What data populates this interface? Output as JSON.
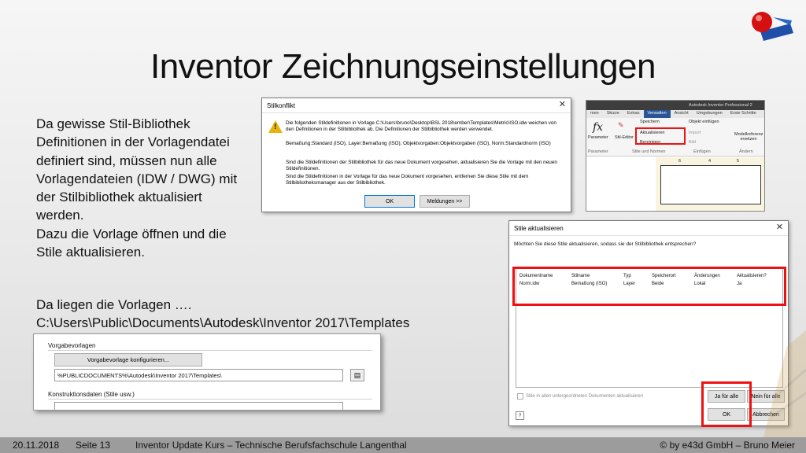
{
  "slide": {
    "title": "Inventor Zeichnungseinstellungen",
    "body_text": "Da gewisse Stil-Bibliothek Definitionen in der Vorlagendatei definiert sind, müssen nun alle Vorlagendateien (IDW / DWG) mit der Stilbibliothek aktualisiert werden.\nDazu die Vorlage öffnen und die Stile aktualisieren.",
    "path_intro": "Da liegen die Vorlagen ….",
    "path": "C:\\Users\\Public\\Documents\\Autodesk\\Inventor 2017\\Templates"
  },
  "stilkonflikt_dialog": {
    "title": "Stilkonflikt",
    "message_1": "Die folgenden Stildefinitionen in Vorlage C:\\Users\\bruno\\Desktop\\BSL 2018\\ember\\Templates\\Metric\\ISO.idw weichen von den Definitionen in der Stilbibliothek ab. Die Definitionen der Stilbibliothek werden verwendet.",
    "message_2": "Bemaßung:Standard (ISO), Layer:Bemaßung (ISO), Objektvorgaben:Objektvorgaben (ISO), Norm:Standardnorm (ISO)",
    "message_3": "Sind die Stildefinitionen der Stilbibliothek für das neue Dokument vorgesehen, aktualisieren Sie die Vorlage mit den neuen Stildefinitionen.",
    "message_4": "Sind die Stildefinitionen in der Vorlage für das neue Dokument vorgesehen, entfernen Sie diese Stile mit dem Stilbibliotheksmanager aus der Stilbibliothek.",
    "ok_label": "OK",
    "details_label": "Meldungen >>"
  },
  "ribbon": {
    "app_title": "Autodesk Inventor Professional 2",
    "tabs": [
      "men",
      "Skizze",
      "Extras",
      "Verwalten",
      "Ansicht",
      "Umgebungen",
      "Erste Schritte"
    ],
    "active_tab": "Verwalten",
    "parameter_label": "Parameter",
    "stil_editor_label": "Stil-Editor",
    "speichern": "Speichern",
    "aktualisieren": "Aktualisieren",
    "bereinigen": "Bereinigen",
    "objekt_einfuegen": "Objekt einfügen",
    "import": "Import",
    "bild": "Bild",
    "modellreferenz": "Modellreferenz ersetzen",
    "group_parameter": "Parameter",
    "group_stile": "Stile und Normen",
    "group_einfuegen": "Einfügen",
    "group_aendern": "Ändern",
    "sheet_numbers": [
      "6",
      "4",
      "5"
    ]
  },
  "stile_dialog": {
    "title": "Stile aktualisieren",
    "question": "Möchten Sie diese Stile aktualisieren, sodass sie der Stilbibliothek entsprechen?",
    "columns": [
      "Dokumentname",
      "Stilname",
      "Typ",
      "Speicherort",
      "Änderungen",
      "Aktualisieren?"
    ],
    "rows": [
      [
        "Norm.idw",
        "Bemaßung (ISO)",
        "Layer",
        "Beide",
        "Lokal",
        "Ja"
      ]
    ],
    "checkbox_label": "Stile in allen untergeordneten Dokumenten aktualisieren",
    "yes_all": "Ja für alle",
    "no_all": "Nein für alle",
    "ok": "OK",
    "cancel": "Abbrechen",
    "help": "?"
  },
  "vorgabe_panel": {
    "group_label": "Vorgabevorlagen",
    "configure_button": "Vorgabevorlage konfigurieren...",
    "path_value": "%PUBLICDOCUMENTS%\\Autodesk\\Inventor 2017\\Templates\\",
    "group2_label": "Konstruktionsdaten (Stile usw.)"
  },
  "footer": {
    "date": "20.11.2018",
    "page": "Seite 13",
    "course": "Inventor Update Kurs – Technische Berufsfachschule Langenthal",
    "copyright": "© by e43d GmbH – Bruno Meier"
  },
  "colors": {
    "highlight_red": "#e11111",
    "active_tab": "#2a5597",
    "footer_bg": "#9c9c9c"
  }
}
